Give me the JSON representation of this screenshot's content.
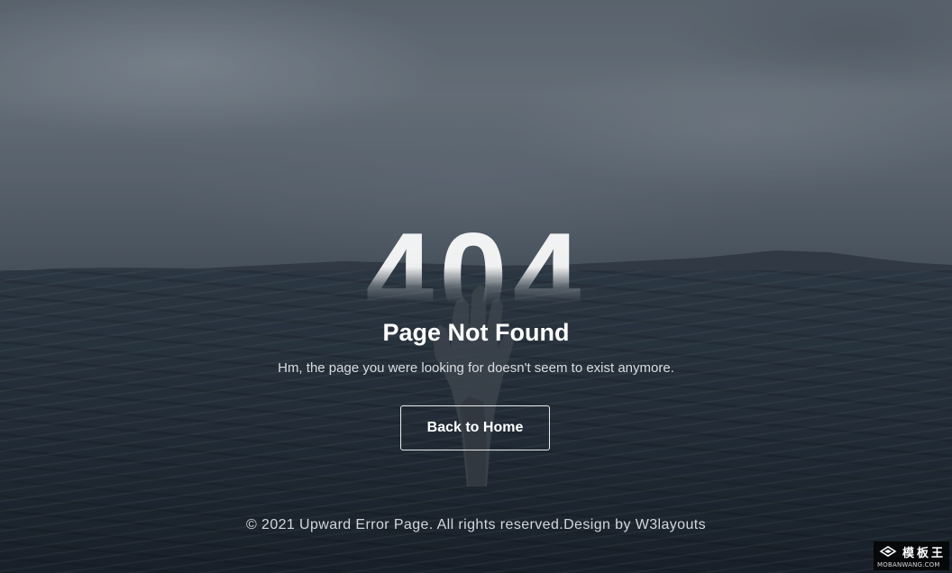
{
  "error": {
    "code": "404",
    "title": "Page Not Found",
    "message": "Hm, the page you were looking for doesn't seem to exist anymore.",
    "home_button_label": "Back to Home"
  },
  "footer": {
    "text": "© 2021 Upward Error Page. All rights reserved.Design by W3layouts"
  },
  "watermark": {
    "logo": "mobanwang-logo-icon",
    "chinese_text": "模板王",
    "domain_text": "MOBANWANG.COM"
  },
  "colors": {
    "text": "#ffffff",
    "button_border": "#ffffff",
    "sea": "#2b3742",
    "sky": "#7c8791"
  },
  "background": {
    "image": "hand-reaching-from-sea-icon"
  }
}
